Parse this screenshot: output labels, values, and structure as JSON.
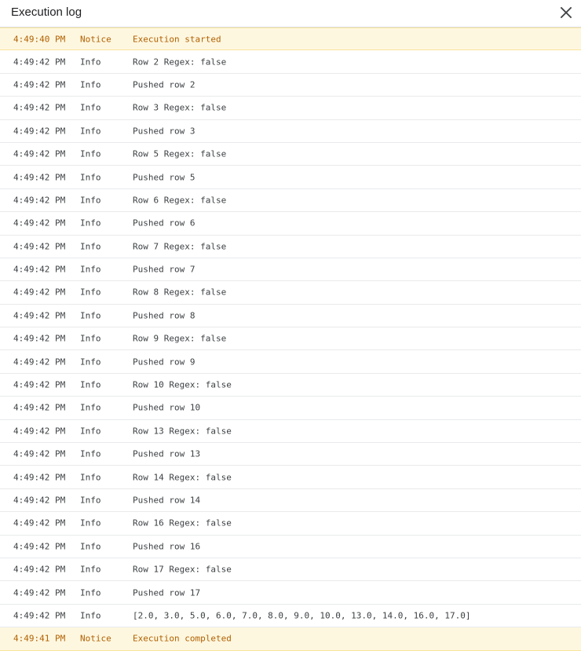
{
  "dialog": {
    "title": "Execution log",
    "close_icon": "close-icon"
  },
  "colors": {
    "notice_bg": "#fef7e0",
    "notice_text": "#b06000",
    "info_text": "#3c4043",
    "divider": "#e8eaed"
  },
  "log": {
    "rows": [
      {
        "time": "4:49:40 PM",
        "level": "Notice",
        "message": "Execution started"
      },
      {
        "time": "4:49:42 PM",
        "level": "Info",
        "message": "Row 2 Regex: false"
      },
      {
        "time": "4:49:42 PM",
        "level": "Info",
        "message": "Pushed row 2"
      },
      {
        "time": "4:49:42 PM",
        "level": "Info",
        "message": "Row 3 Regex: false"
      },
      {
        "time": "4:49:42 PM",
        "level": "Info",
        "message": "Pushed row 3"
      },
      {
        "time": "4:49:42 PM",
        "level": "Info",
        "message": "Row 5 Regex: false"
      },
      {
        "time": "4:49:42 PM",
        "level": "Info",
        "message": "Pushed row 5"
      },
      {
        "time": "4:49:42 PM",
        "level": "Info",
        "message": "Row 6 Regex: false"
      },
      {
        "time": "4:49:42 PM",
        "level": "Info",
        "message": "Pushed row 6"
      },
      {
        "time": "4:49:42 PM",
        "level": "Info",
        "message": "Row 7 Regex: false"
      },
      {
        "time": "4:49:42 PM",
        "level": "Info",
        "message": "Pushed row 7"
      },
      {
        "time": "4:49:42 PM",
        "level": "Info",
        "message": "Row 8 Regex: false"
      },
      {
        "time": "4:49:42 PM",
        "level": "Info",
        "message": "Pushed row 8"
      },
      {
        "time": "4:49:42 PM",
        "level": "Info",
        "message": "Row 9 Regex: false"
      },
      {
        "time": "4:49:42 PM",
        "level": "Info",
        "message": "Pushed row 9"
      },
      {
        "time": "4:49:42 PM",
        "level": "Info",
        "message": "Row 10 Regex: false"
      },
      {
        "time": "4:49:42 PM",
        "level": "Info",
        "message": "Pushed row 10"
      },
      {
        "time": "4:49:42 PM",
        "level": "Info",
        "message": "Row 13 Regex: false"
      },
      {
        "time": "4:49:42 PM",
        "level": "Info",
        "message": "Pushed row 13"
      },
      {
        "time": "4:49:42 PM",
        "level": "Info",
        "message": "Row 14 Regex: false"
      },
      {
        "time": "4:49:42 PM",
        "level": "Info",
        "message": "Pushed row 14"
      },
      {
        "time": "4:49:42 PM",
        "level": "Info",
        "message": "Row 16 Regex: false"
      },
      {
        "time": "4:49:42 PM",
        "level": "Info",
        "message": "Pushed row 16"
      },
      {
        "time": "4:49:42 PM",
        "level": "Info",
        "message": "Row 17 Regex: false"
      },
      {
        "time": "4:49:42 PM",
        "level": "Info",
        "message": "Pushed row 17"
      },
      {
        "time": "4:49:42 PM",
        "level": "Info",
        "message": "[2.0, 3.0, 5.0, 6.0, 7.0, 8.0, 9.0, 10.0, 13.0, 14.0, 16.0, 17.0]"
      },
      {
        "time": "4:49:41 PM",
        "level": "Notice",
        "message": "Execution completed"
      }
    ]
  }
}
